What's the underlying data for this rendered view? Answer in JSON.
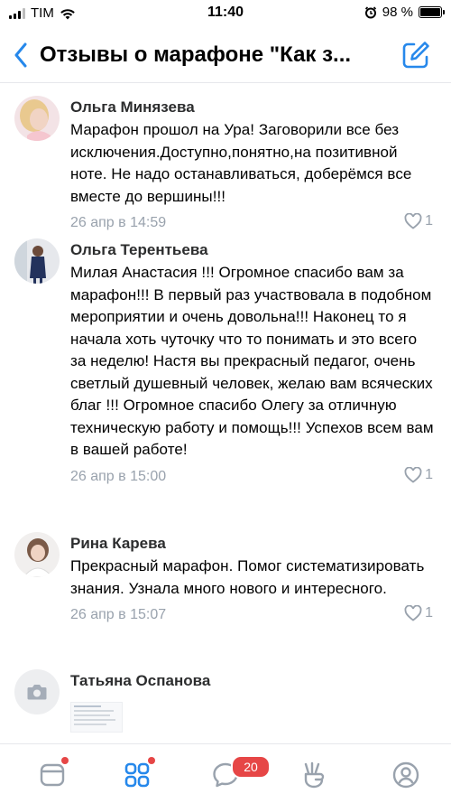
{
  "status_bar": {
    "carrier": "TIM",
    "time": "11:40",
    "battery": "98 %",
    "battery_level": 0.98
  },
  "header": {
    "back_icon": "chevron-left-icon",
    "title": "Отзывы о марафоне \"Как з...",
    "compose_icon": "edit-icon"
  },
  "comments": [
    {
      "name": "Ольга Минязева",
      "text": "Марафон прошол на Ура! Заговорили все без исключения.Доступно,понятно,на позитивной ноте. Не надо останавливаться, доберёмся все вместе до вершины!!!",
      "date": "26 апр в 14:59",
      "likes": "1"
    },
    {
      "name": "Ольга Терентьева",
      "text": "Милая Анастасия !!! Огромное спасибо вам за марафон!!! В первый раз участвовала в подобном мероприятии и очень довольна!!! Наконец то я начала хоть чуточку что то понимать и это всего за неделю! Настя вы прекрасный педагог, очень светлый душевный человек, желаю вам всяческих благ !!! Огромное спасибо Олегу за отличную техническую работу и помощь!!! Успехов всем вам в вашей работе!",
      "date": "26 апр в 15:00",
      "likes": "1"
    },
    {
      "name": "Рина Карева",
      "text": "Прекрасный марафон. Помог систематизировать знания. Узнала много нового и интересного.",
      "date": "26 апр в 15:07",
      "likes": "1"
    },
    {
      "name": "Татьяна Оспанова"
    }
  ],
  "tabbar": {
    "items": [
      {
        "icon": "news-icon"
      },
      {
        "icon": "services-icon"
      },
      {
        "icon": "messages-icon"
      },
      {
        "icon": "clips-icon"
      },
      {
        "icon": "profile-icon"
      }
    ],
    "messages_badge": "20"
  },
  "colors": {
    "accent": "#2688eb",
    "meta_gray": "#99a2ad",
    "badge_red": "#e64646",
    "divider": "#e7e8ec"
  }
}
